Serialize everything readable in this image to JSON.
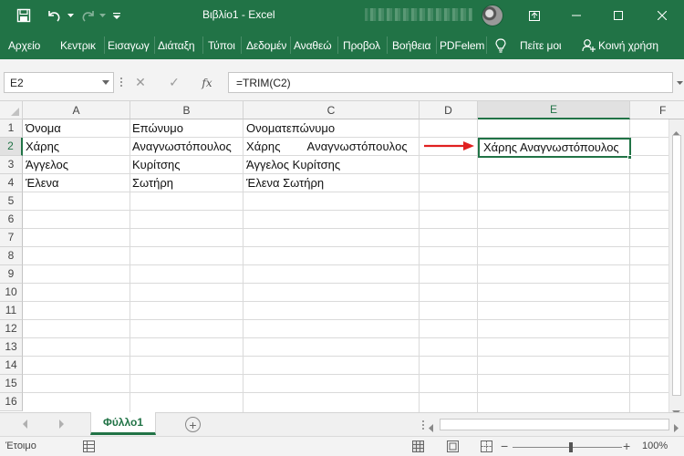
{
  "window": {
    "title": "Βιβλίο1  -  Excel",
    "accent": "#217346"
  },
  "qat": {
    "icons": [
      "save-icon",
      "undo-icon",
      "undo-dropdown-icon",
      "redo-icon",
      "redo-dropdown-icon",
      "customize-qat-icon"
    ]
  },
  "window_controls": {
    "icons": [
      "ribbon-display-icon",
      "minimize-icon",
      "restore-icon",
      "close-icon"
    ]
  },
  "ribbon": {
    "tabs": [
      {
        "label": "Αρχείο"
      },
      {
        "label": "Κεντρικ"
      },
      {
        "label": "Εισαγωγ"
      },
      {
        "label": "Διάταξη"
      },
      {
        "label": "Τύποι"
      },
      {
        "label": "Δεδομέν"
      },
      {
        "label": "Αναθεώ"
      },
      {
        "label": "Προβολ"
      },
      {
        "label": "Βοήθεια"
      },
      {
        "label": "PDFelem"
      }
    ],
    "tell_me": "Πείτε μοι",
    "share": "Κοινή χρήση"
  },
  "formula_bar": {
    "name_box": "E2",
    "cancel_glyph": "✕",
    "enter_glyph": "✓",
    "fx_glyph": "fx",
    "formula": "=TRIM(C2)"
  },
  "sheet": {
    "columns": [
      "A",
      "B",
      "C",
      "D",
      "E",
      "F"
    ],
    "rows": [
      "1",
      "2",
      "3",
      "4",
      "5",
      "6",
      "7",
      "8",
      "9",
      "10",
      "11",
      "12",
      "13",
      "14",
      "15",
      "16"
    ],
    "selected_column": "E",
    "selected_row": "2",
    "cells": {
      "A1": "Όνομα",
      "B1": "Επώνυμο",
      "C1": "Ονοματεπώνυμο",
      "A2": "Χάρης",
      "B2": "Αναγνωστόπουλος",
      "C2": "Χάρης        Αναγνωστόπουλος",
      "E2": "Χάρης Αναγνωστόπουλος",
      "A3": "Άγγελος",
      "B3": "Κυρίτσης",
      "C3": "Άγγελος Κυρίτσης",
      "A4": "Έλενα",
      "B4": "Σωτήρη",
      "C4": "Έλενα Σωτήρη"
    },
    "annotation_arrow_color": "#e02020"
  },
  "sheet_tabs": {
    "active": "Φύλλο1",
    "add_glyph": "+"
  },
  "status_bar": {
    "mode": "Έτοιμο",
    "zoom_minus": "−",
    "zoom_plus": "+",
    "zoom": "100%"
  }
}
